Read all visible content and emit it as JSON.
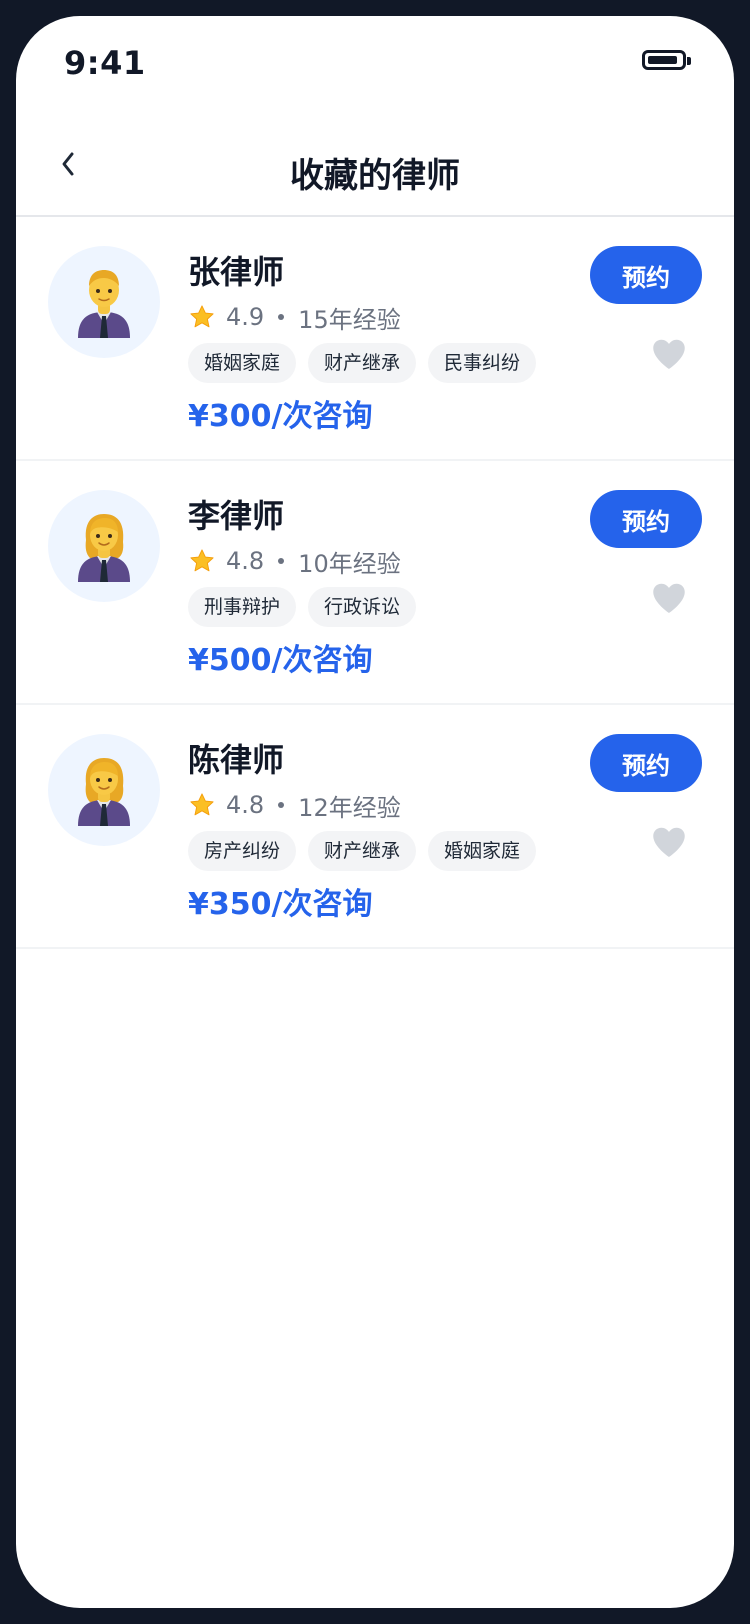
{
  "status_bar": {
    "time": "9:41"
  },
  "header": {
    "back_icon": "chevron-left-icon",
    "title": "收藏的律师"
  },
  "lawyers": [
    {
      "name": "张律师",
      "avatar_icon": "man-office-worker-icon",
      "rating": "4.9",
      "experience": "15年经验",
      "tags": [
        "婚姻家庭",
        "财产继承",
        "民事纠纷"
      ],
      "price": "¥300/次咨询",
      "book_label": "预约",
      "favorited_icon": "heart-icon"
    },
    {
      "name": "李律师",
      "avatar_icon": "woman-office-worker-icon",
      "rating": "4.8",
      "experience": "10年经验",
      "tags": [
        "刑事辩护",
        "行政诉讼"
      ],
      "price": "¥500/次咨询",
      "book_label": "预约",
      "favorited_icon": "heart-icon"
    },
    {
      "name": "陈律师",
      "avatar_icon": "woman-office-worker-icon",
      "rating": "4.8",
      "experience": "12年经验",
      "tags": [
        "房产纠纷",
        "财产继承",
        "婚姻家庭"
      ],
      "price": "¥350/次咨询",
      "book_label": "预约",
      "favorited_icon": "heart-icon"
    }
  ],
  "colors": {
    "accent": "#2563eb",
    "frame": "#111827",
    "avatar_bg": "#eef5ff",
    "heart": "#d1d5db",
    "star": "#fbbf24"
  }
}
